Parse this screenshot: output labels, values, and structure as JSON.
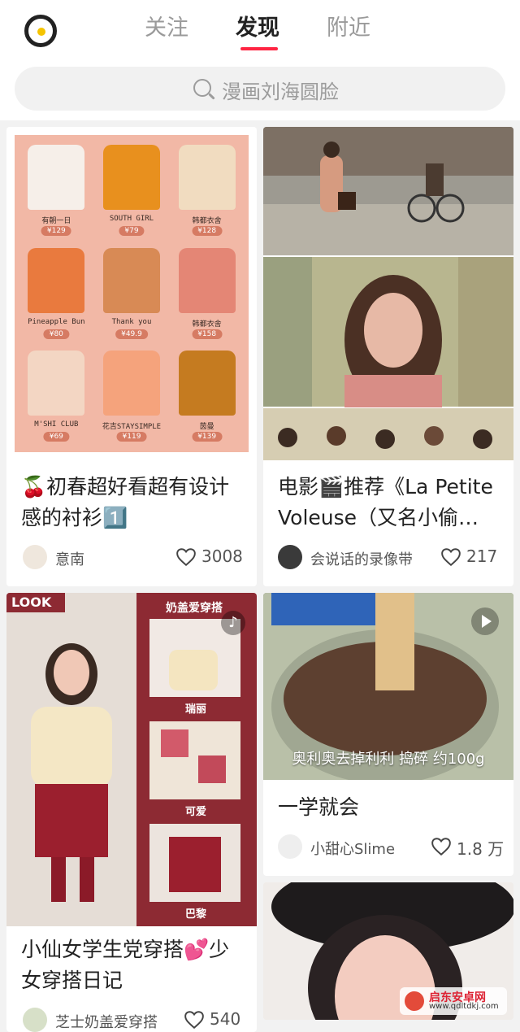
{
  "tabs": [
    "关注",
    "发现",
    "附近"
  ],
  "search": {
    "placeholder": "漫画刘海圆脸"
  },
  "cards": [
    {
      "title": "🍒初春超好看超有设计感的衬衫1️⃣",
      "author": "意南",
      "likes": "3008",
      "shirts": [
        {
          "label": "有朝一日",
          "price": "¥129",
          "color": "#f6efe9"
        },
        {
          "label": "SOUTH GIRL",
          "price": "¥79",
          "color": "#e8901e"
        },
        {
          "label": "韩都衣舍",
          "price": "¥128",
          "color": "#f1dcc0"
        },
        {
          "label": "Pineapple Bun",
          "price": "¥80",
          "color": "#e97a3e"
        },
        {
          "label": "Thank you",
          "price": "¥49.9",
          "color": "#d88a55"
        },
        {
          "label": "韩都衣舍",
          "price": "¥158",
          "color": "#e48675"
        },
        {
          "label": "M'SHI CLUB",
          "price": "¥69",
          "color": "#f3d6c3"
        },
        {
          "label": "花吉STAYSIMPLE",
          "price": "¥119",
          "color": "#f5a37c"
        },
        {
          "label": "茵曼",
          "price": "¥139",
          "color": "#c57b20"
        }
      ]
    },
    {
      "title": "电影🎬推荐《La Petite Voleuse（又名小偷…",
      "author": "会说话的录像带",
      "likes": "217"
    },
    {
      "title": "小仙女学生党穿搭💕少女穿搭日记",
      "author": "芝士奶盖爱穿搭",
      "likes": "540",
      "badge": "LOOK",
      "side_title": "奶盖爱穿搭",
      "side_labels": [
        "瑞丽",
        "可爱",
        "巴黎"
      ]
    },
    {
      "title": "一学就会",
      "author": "小甜心Slime",
      "likes": "1.8 万",
      "caption": "奥利奥去掉利利 捣碎 约100g"
    }
  ],
  "watermark": {
    "name": "启东安卓网",
    "url": "www.qdltdkj.com"
  },
  "colors": {
    "accent": "#ff2442",
    "active_tab": "#222222"
  }
}
